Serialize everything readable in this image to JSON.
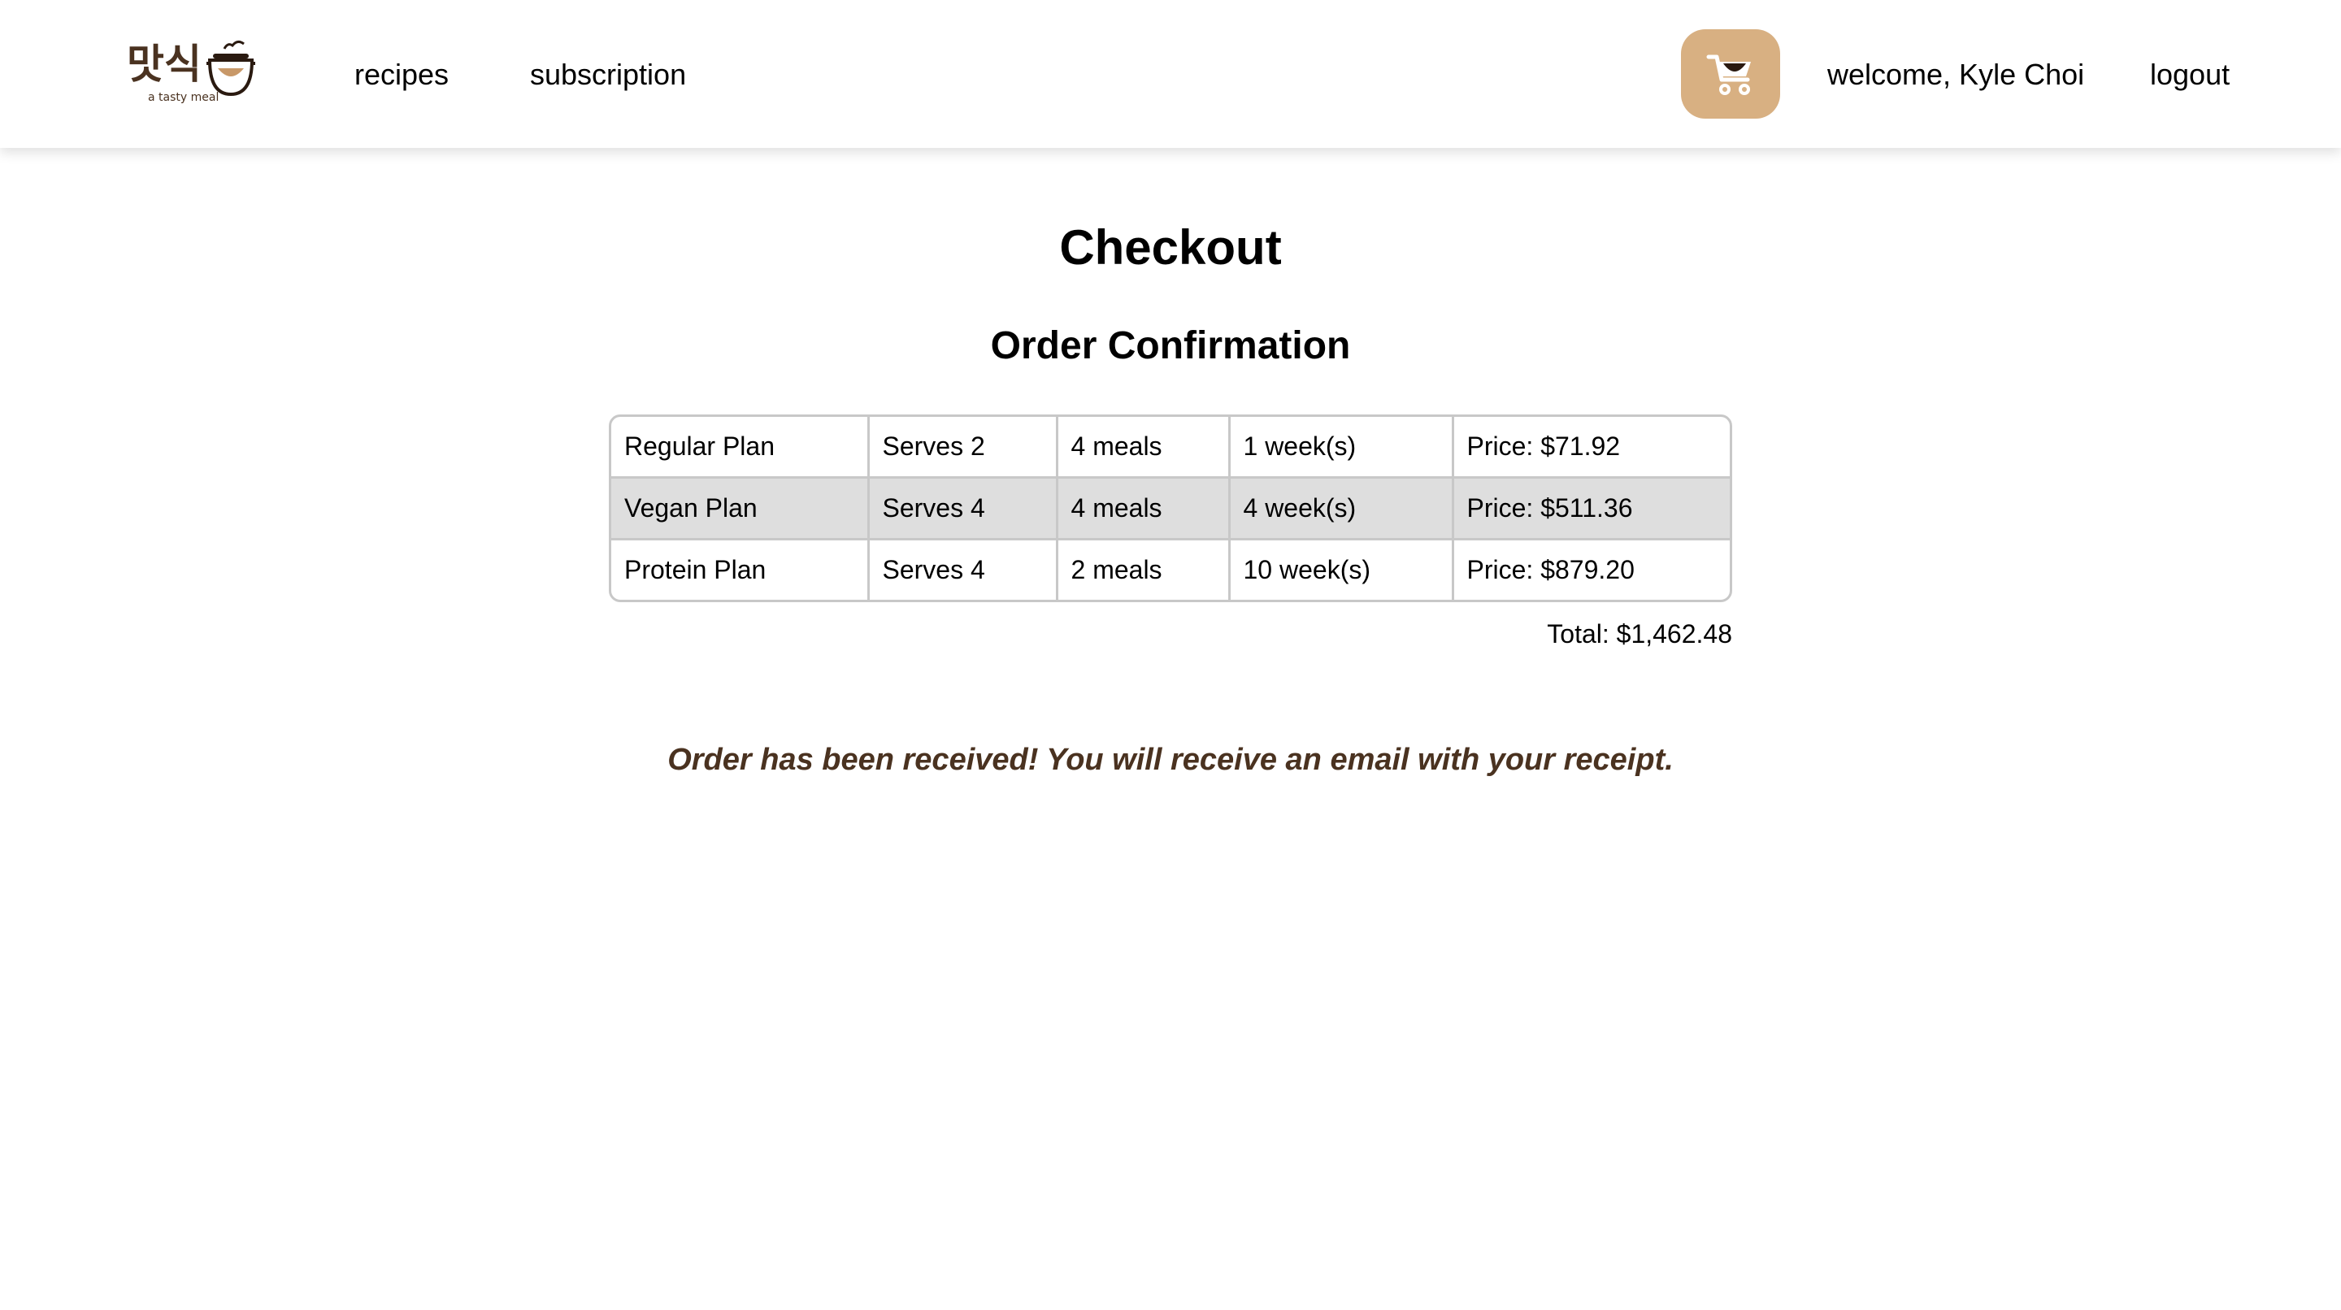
{
  "nav": {
    "logo_text": "맛식",
    "logo_tagline": "a tasty meal",
    "links": [
      "recipes",
      "subscription"
    ],
    "welcome": "welcome, Kyle Choi",
    "logout": "logout",
    "cart_icon": "shopping-cart-icon",
    "cart_color": "#d8b082",
    "brand_color": "#4a3220"
  },
  "main": {
    "title": "Checkout",
    "section_title": "Order Confirmation",
    "orders": [
      {
        "plan": "Regular Plan",
        "serves": "Serves 2",
        "meals": "4 meals",
        "weeks": "1 week(s)",
        "price": "Price: $71.92"
      },
      {
        "plan": "Vegan Plan",
        "serves": "Serves 4",
        "meals": "4 meals",
        "weeks": "4 week(s)",
        "price": "Price: $511.36"
      },
      {
        "plan": "Protein Plan",
        "serves": "Serves 4",
        "meals": "2 meals",
        "weeks": "10 week(s)",
        "price": "Price: $879.20"
      }
    ],
    "total": "Total: $1,462.48",
    "confirmation_message": "Order has been received! You will receive an email with your receipt."
  }
}
